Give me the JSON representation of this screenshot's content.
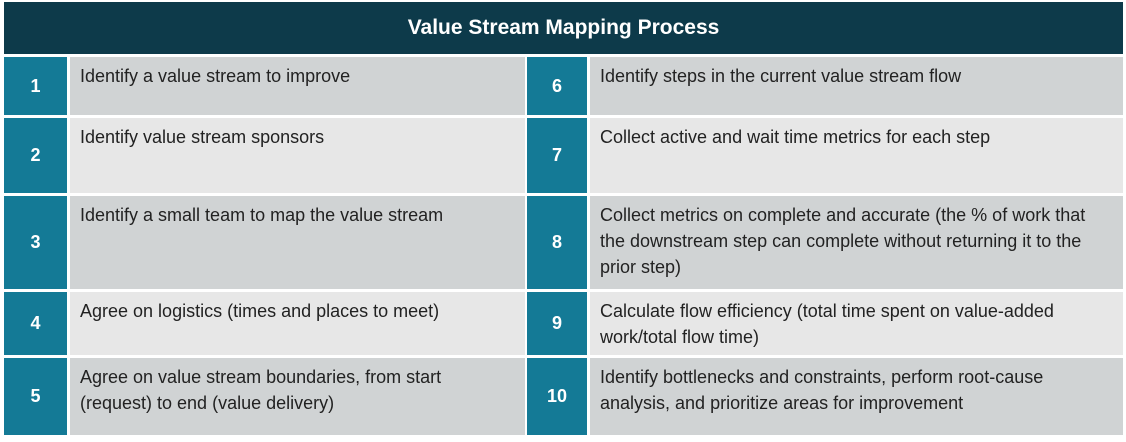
{
  "title": "Value Stream Mapping Process",
  "colors": {
    "title_bg": "#0d3a4a",
    "number_bg": "#147a96",
    "row_dark": "#d0d3d4",
    "row_light": "#e7e7e7"
  },
  "left_steps": [
    {
      "number": "1",
      "text": "Identify a value stream to improve"
    },
    {
      "number": "2",
      "text": "Identify value stream sponsors"
    },
    {
      "number": "3",
      "text": "Identify a small team to map the value stream"
    },
    {
      "number": "4",
      "text": "Agree on logistics (times and places to meet)"
    },
    {
      "number": "5",
      "text": "Agree on value stream boundaries, from start (request) to end (value delivery)"
    }
  ],
  "right_steps": [
    {
      "number": "6",
      "text": "Identify steps in the current value stream flow"
    },
    {
      "number": "7",
      "text": "Collect active and wait time metrics for each step"
    },
    {
      "number": "8",
      "text": "Collect metrics on complete and accurate (the % of work that the downstream step can complete without returning it to the prior step)"
    },
    {
      "number": "9",
      "text": "Calculate flow efficiency (total time spent on value-added work/total flow time)"
    },
    {
      "number": "10",
      "text": "Identify bottlenecks and constraints, perform root-cause analysis, and prioritize areas for improvement"
    }
  ]
}
